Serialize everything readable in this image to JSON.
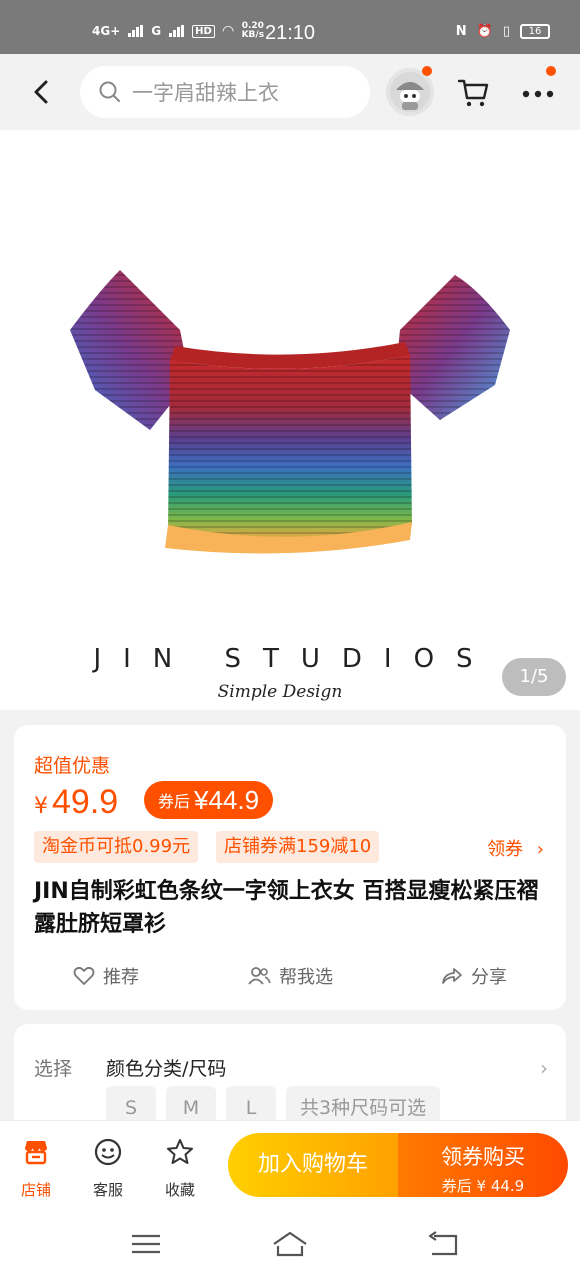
{
  "status_bar": {
    "net1": "4G+",
    "net2": "G",
    "hd": "HD",
    "speed_value": "0.20",
    "speed_unit": "KB/s",
    "time": "21:10",
    "battery": "16"
  },
  "search": {
    "placeholder": "一字肩甜辣上衣"
  },
  "hero": {
    "brand": "JIN STUDIOS",
    "tagline": "Simple Design",
    "pager": "1/5"
  },
  "product": {
    "deal_label": "超值优惠",
    "currency": "¥",
    "price": "49.9",
    "coupon_prefix": "券后",
    "coupon_price": "¥44.9",
    "tags": [
      "淘金币可抵0.99元",
      "店铺券满159减10"
    ],
    "get_coupon": "领券",
    "title": "JIN自制彩虹色条纹一字领上衣女 百搭显瘦松紧压褶露肚脐短罩衫",
    "actions": {
      "recommend": "推荐",
      "help_choose": "帮我选",
      "share": "分享"
    }
  },
  "selection": {
    "label": "选择",
    "value": "颜色分类/尺码",
    "sizes": [
      "S",
      "M",
      "L"
    ],
    "more": "共3种尺码可选"
  },
  "bottom_bar": {
    "store": "店铺",
    "service": "客服",
    "favorite": "收藏",
    "add_to_cart": "加入购物车",
    "buy_label": "领券购买",
    "buy_sub": "券后 ¥ 44.9"
  },
  "colors": {
    "accent": "#ff5000",
    "cart_button": "#ffb300",
    "buy_button": "#ff5a00"
  }
}
